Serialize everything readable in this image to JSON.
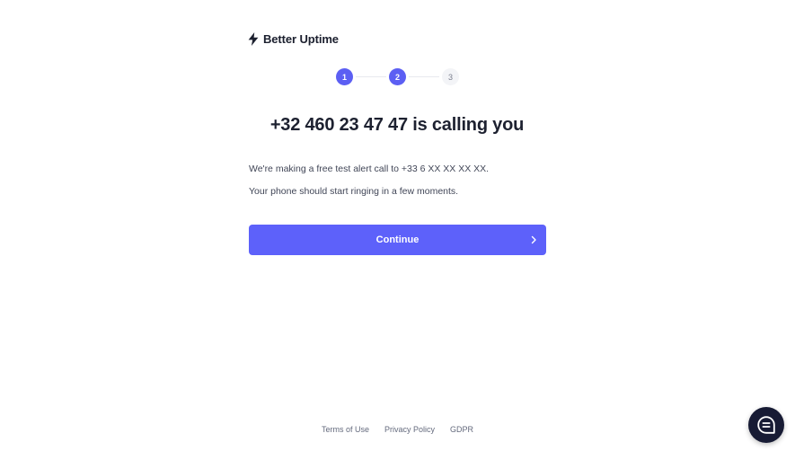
{
  "brand": {
    "name": "Better Uptime",
    "icon": "lightning-bolt-icon"
  },
  "stepper": {
    "steps": [
      {
        "label": "1",
        "state": "completed"
      },
      {
        "label": "2",
        "state": "current"
      },
      {
        "label": "3",
        "state": "pending"
      }
    ]
  },
  "main": {
    "title": "+32 460 23 47 47 is calling you",
    "paragraph_1": "We're making a free test alert call to +33 6 XX XX XX XX.",
    "paragraph_2": "Your phone should start ringing in a few moments.",
    "continue_label": "Continue",
    "continue_icon": "chevron-right-icon"
  },
  "footer": {
    "links": [
      "Terms of Use",
      "Privacy Policy",
      "GDPR"
    ]
  },
  "chat_widget": {
    "icon": "chat-bubble-icon"
  },
  "colors": {
    "accent": "#5d61fa",
    "step_active": "#5c5ff3",
    "chat_bg": "#171b34",
    "text_dark": "#1d2130"
  }
}
